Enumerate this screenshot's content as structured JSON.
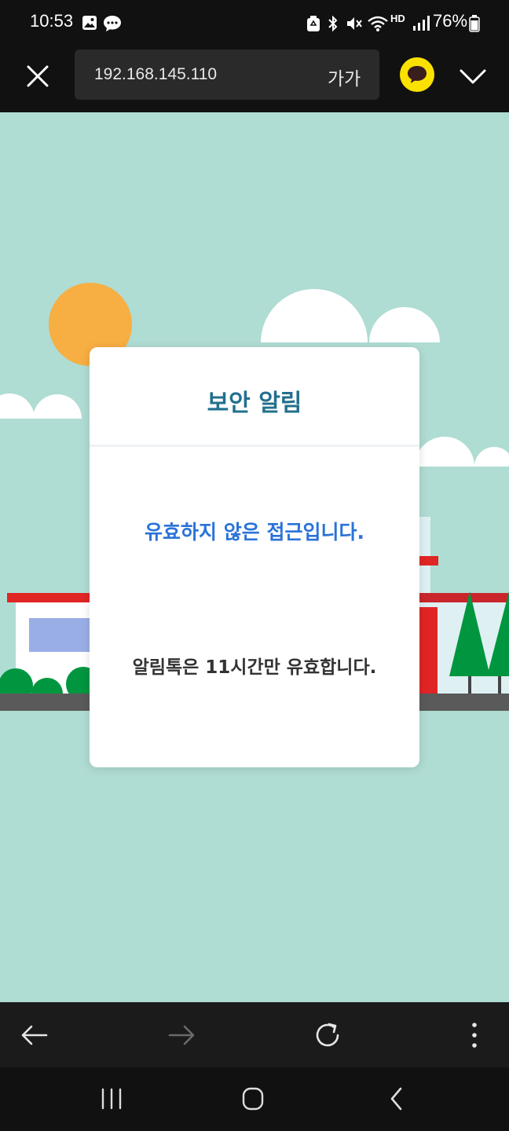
{
  "status_bar": {
    "time": "10:53",
    "battery_percent": "76%",
    "icons": [
      "gallery-icon",
      "message-icon",
      "recycle-icon",
      "bluetooth-icon",
      "mute-icon",
      "wifi-icon",
      "hd-voice-icon",
      "signal-icon",
      "battery-icon"
    ],
    "hd_label": "HD"
  },
  "browser": {
    "url": "192.168.145.110",
    "font_size_label": "가가",
    "close_icon": "close-icon",
    "kakao_icon": "kakaotalk-icon",
    "menu_icon": "chevron-down-icon"
  },
  "modal": {
    "title": "보안 알림",
    "message_primary": "유효하지 않은 접근입니다.",
    "message_secondary": "알림톡은 11시간만 유효합니다."
  },
  "colors": {
    "background": "#afdcd3",
    "title": "#22708e",
    "message_primary": "#2b73d8",
    "kakao_yellow": "#fae100",
    "sun": "#f7ae42",
    "roof_red": "#e02525",
    "tree_green": "#00963f"
  },
  "bottom_bar": {
    "icons": [
      "back-arrow-icon",
      "forward-arrow-icon",
      "refresh-icon",
      "more-vertical-icon"
    ]
  },
  "system_nav": {
    "icons": [
      "recent-apps-icon",
      "home-icon",
      "back-icon"
    ]
  }
}
